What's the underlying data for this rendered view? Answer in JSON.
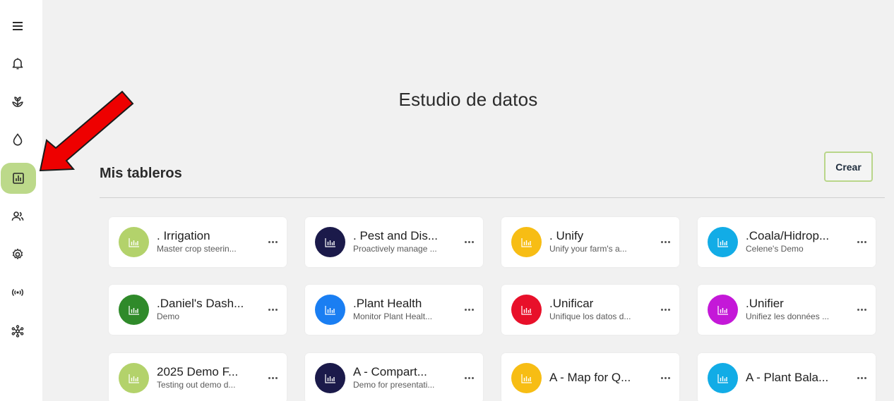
{
  "page": {
    "title": "Estudio de datos",
    "section_title": "Mis tableros",
    "create_label": "Crear"
  },
  "sidebar": {
    "items": [
      {
        "icon": "menu-icon"
      },
      {
        "icon": "bell-icon"
      },
      {
        "icon": "plant-icon"
      },
      {
        "icon": "water-drop-icon"
      },
      {
        "icon": "bar-chart-icon",
        "active": true
      },
      {
        "icon": "users-icon"
      },
      {
        "icon": "gear-icon"
      },
      {
        "icon": "broadcast-icon"
      },
      {
        "icon": "network-icon"
      }
    ],
    "active_color": "#bcd98a"
  },
  "dashboards": [
    {
      "title": ". Irrigation",
      "subtitle": "Master crop steerin...",
      "color": "#b3d26b"
    },
    {
      "title": ". Pest and Dis...",
      "subtitle": "Proactively manage ...",
      "color": "#1b1a4a"
    },
    {
      "title": ". Unify",
      "subtitle": "Unify your farm's a...",
      "color": "#f7bd14"
    },
    {
      "title": ".Coala/Hidrop...",
      "subtitle": "Celene's Demo",
      "color": "#12ace6"
    },
    {
      "title": ".Daniel's Dash...",
      "subtitle": "Demo",
      "color": "#2f8a2a"
    },
    {
      "title": ".Plant Health",
      "subtitle": "Monitor Plant Healt...",
      "color": "#1a7ef2"
    },
    {
      "title": ".Unificar",
      "subtitle": "Unifique los datos d...",
      "color": "#e8102a"
    },
    {
      "title": ".Unifier",
      "subtitle": "Unifiez les données ...",
      "color": "#c418d8"
    },
    {
      "title": "2025 Demo F...",
      "subtitle": "Testing out demo d...",
      "color": "#b3d26b"
    },
    {
      "title": "A - Compart...",
      "subtitle": "Demo for presentati...",
      "color": "#1b1a4a"
    },
    {
      "title": "A - Map for Q...",
      "subtitle": "",
      "color": "#f7bd14"
    },
    {
      "title": "A - Plant Bala...",
      "subtitle": "",
      "color": "#12ace6"
    }
  ]
}
